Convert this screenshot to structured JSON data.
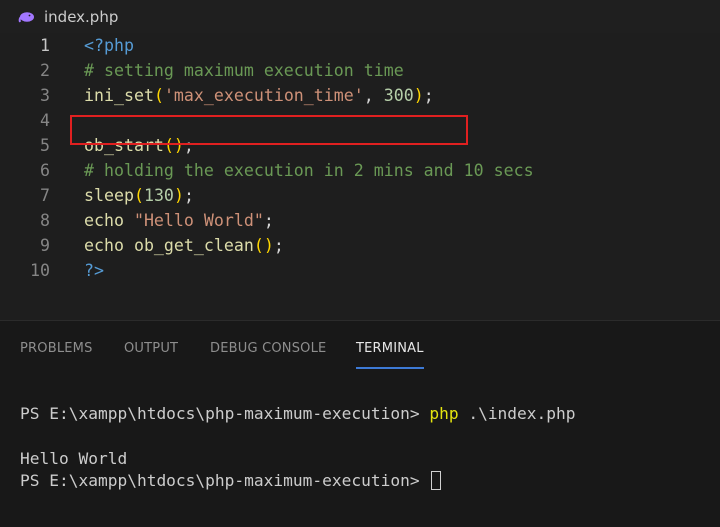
{
  "tab": {
    "filename": "index.php",
    "icon": "php-elephant-icon"
  },
  "editor": {
    "lines": [
      {
        "number": "1",
        "tokens": [
          {
            "t": "<?php",
            "c": "kw"
          }
        ]
      },
      {
        "number": "2",
        "tokens": [
          {
            "t": "# setting maximum execution time",
            "c": "cmt"
          }
        ]
      },
      {
        "number": "3",
        "tokens": [
          {
            "t": "ini_set",
            "c": "fn"
          },
          {
            "t": "(",
            "c": "par"
          },
          {
            "t": "'max_execution_time'",
            "c": "str"
          },
          {
            "t": ", ",
            "c": "txt"
          },
          {
            "t": "300",
            "c": "num"
          },
          {
            "t": ")",
            "c": "par"
          },
          {
            "t": ";",
            "c": "txt"
          }
        ]
      },
      {
        "number": "4",
        "tokens": []
      },
      {
        "number": "5",
        "tokens": [
          {
            "t": "ob_start",
            "c": "fn"
          },
          {
            "t": "()",
            "c": "par"
          },
          {
            "t": ";",
            "c": "txt"
          }
        ]
      },
      {
        "number": "6",
        "tokens": [
          {
            "t": "# holding the execution in 2 mins and 10 secs",
            "c": "cmt"
          }
        ]
      },
      {
        "number": "7",
        "tokens": [
          {
            "t": "sleep",
            "c": "fn"
          },
          {
            "t": "(",
            "c": "par"
          },
          {
            "t": "130",
            "c": "num"
          },
          {
            "t": ")",
            "c": "par"
          },
          {
            "t": ";",
            "c": "txt"
          }
        ]
      },
      {
        "number": "8",
        "tokens": [
          {
            "t": "echo ",
            "c": "fn"
          },
          {
            "t": "\"Hello World\"",
            "c": "str"
          },
          {
            "t": ";",
            "c": "txt"
          }
        ]
      },
      {
        "number": "9",
        "tokens": [
          {
            "t": "echo ",
            "c": "fn"
          },
          {
            "t": "ob_get_clean",
            "c": "fn"
          },
          {
            "t": "()",
            "c": "par"
          },
          {
            "t": ";",
            "c": "txt"
          }
        ]
      },
      {
        "number": "10",
        "tokens": [
          {
            "t": "?>",
            "c": "kw"
          }
        ]
      }
    ],
    "highlighted_line": 3,
    "highlight_color": "#e02020"
  },
  "panel": {
    "tabs": [
      "PROBLEMS",
      "OUTPUT",
      "DEBUG CONSOLE",
      "TERMINAL"
    ],
    "active_tab": "TERMINAL",
    "accent": "#3d7ad6"
  },
  "terminal": {
    "prompt": "PS E:\\xampp\\htdocs\\php-maximum-execution> ",
    "command": "php",
    "args": " .\\index.php",
    "output": "Hello World",
    "prompt2": "PS E:\\xampp\\htdocs\\php-maximum-execution> "
  }
}
